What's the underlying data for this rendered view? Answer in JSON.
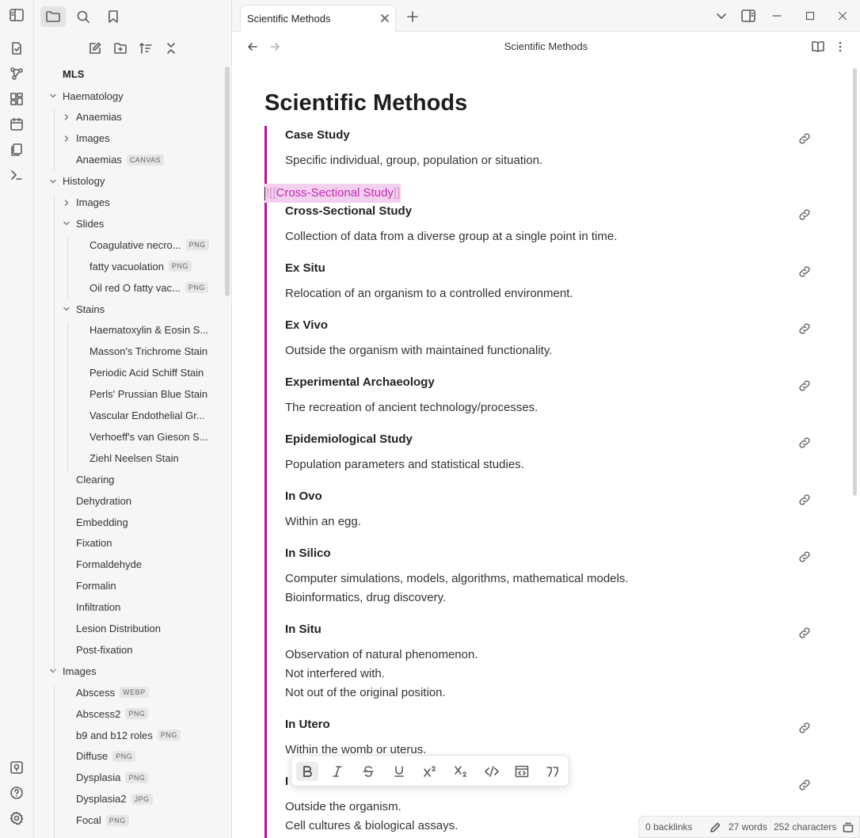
{
  "sidebar": {
    "vault_name": "MLS",
    "tree": [
      {
        "label": "Haematology",
        "level": 0,
        "state": "open"
      },
      {
        "label": "Anaemias",
        "level": 1,
        "state": "closed"
      },
      {
        "label": "Images",
        "level": 1,
        "state": "closed"
      },
      {
        "label": "Anaemias",
        "level": 1,
        "state": "file",
        "tag": "CANVAS"
      },
      {
        "label": "Histology",
        "level": 0,
        "state": "open"
      },
      {
        "label": "Images",
        "level": 1,
        "state": "closed"
      },
      {
        "label": "Slides",
        "level": 1,
        "state": "open"
      },
      {
        "label": "Coagulative necro...",
        "level": 2,
        "state": "file",
        "tag": "PNG"
      },
      {
        "label": "fatty vacuolation",
        "level": 2,
        "state": "file",
        "tag": "PNG"
      },
      {
        "label": "Oil red O fatty vac...",
        "level": 2,
        "state": "file",
        "tag": "PNG"
      },
      {
        "label": "Stains",
        "level": 1,
        "state": "open"
      },
      {
        "label": "Haematoxylin & Eosin S...",
        "level": 2,
        "state": "file"
      },
      {
        "label": "Masson's Trichrome Stain",
        "level": 2,
        "state": "file"
      },
      {
        "label": "Periodic Acid Schiff Stain",
        "level": 2,
        "state": "file"
      },
      {
        "label": "Perls' Prussian Blue Stain",
        "level": 2,
        "state": "file"
      },
      {
        "label": "Vascular Endothelial Gr...",
        "level": 2,
        "state": "file"
      },
      {
        "label": "Verhoeff's van Gieson S...",
        "level": 2,
        "state": "file"
      },
      {
        "label": "Ziehl Neelsen Stain",
        "level": 2,
        "state": "file"
      },
      {
        "label": "Clearing",
        "level": 1,
        "state": "file"
      },
      {
        "label": "Dehydration",
        "level": 1,
        "state": "file"
      },
      {
        "label": "Embedding",
        "level": 1,
        "state": "file"
      },
      {
        "label": "Fixation",
        "level": 1,
        "state": "file"
      },
      {
        "label": "Formaldehyde",
        "level": 1,
        "state": "file"
      },
      {
        "label": "Formalin",
        "level": 1,
        "state": "file"
      },
      {
        "label": "Infiltration",
        "level": 1,
        "state": "file"
      },
      {
        "label": "Lesion Distribution",
        "level": 1,
        "state": "file"
      },
      {
        "label": "Post-fixation",
        "level": 1,
        "state": "file"
      },
      {
        "label": "Images",
        "level": 0,
        "state": "open"
      },
      {
        "label": "Abscess",
        "level": 1,
        "state": "file",
        "tag": "WEBP"
      },
      {
        "label": "Abscess2",
        "level": 1,
        "state": "file",
        "tag": "PNG"
      },
      {
        "label": "b9 and b12 roles",
        "level": 1,
        "state": "file",
        "tag": "PNG"
      },
      {
        "label": "Diffuse",
        "level": 1,
        "state": "file",
        "tag": "PNG"
      },
      {
        "label": "Dysplasia",
        "level": 1,
        "state": "file",
        "tag": "PNG"
      },
      {
        "label": "Dysplasia2",
        "level": 1,
        "state": "file",
        "tag": "JPG"
      },
      {
        "label": "Focal",
        "level": 1,
        "state": "file",
        "tag": "PNG"
      }
    ]
  },
  "tab": {
    "title": "Scientific Methods"
  },
  "view": {
    "title": "Scientific Methods"
  },
  "note": {
    "title": "Scientific Methods",
    "wikilink": {
      "open": "![[",
      "target": "Cross-Sectional Study",
      "close": "]]"
    },
    "entries": [
      {
        "title": "Case Study",
        "lines": [
          "Specific individual, group, population or situation."
        ]
      },
      {
        "title": "Cross-Sectional Study",
        "lines": [
          "Collection of data from a diverse group at a single point in time."
        ]
      },
      {
        "title": "Ex Situ",
        "lines": [
          "Relocation of an organism to a controlled environment."
        ]
      },
      {
        "title": "Ex Vivo",
        "lines": [
          "Outside the organism with maintained functionality."
        ]
      },
      {
        "title": "Experimental Archaeology",
        "lines": [
          "The recreation of ancient technology/processes."
        ]
      },
      {
        "title": "Epidemiological Study",
        "lines": [
          "Population parameters and statistical studies."
        ]
      },
      {
        "title": "In Ovo",
        "lines": [
          "Within an egg."
        ]
      },
      {
        "title": "In Silico",
        "lines": [
          "Computer simulations, models, algorithms, mathematical models.",
          "Bioinformatics, drug discovery."
        ]
      },
      {
        "title": "In Situ",
        "lines": [
          "Observation of natural phenomenon.",
          "Not interfered with.",
          "Not out of the original position."
        ]
      },
      {
        "title": "In Utero",
        "lines": [
          "Within the womb or uterus."
        ]
      },
      {
        "title": "I",
        "lines": [
          "Outside the organism.",
          "Cell cultures & biological assays."
        ]
      }
    ]
  },
  "status": {
    "backlinks": "0 backlinks",
    "words": "27 words",
    "characters": "252 characters"
  },
  "colors": {
    "accent": "#b0149c",
    "link_text": "#c22bb3",
    "link_highlight": "#f3d0ee"
  }
}
